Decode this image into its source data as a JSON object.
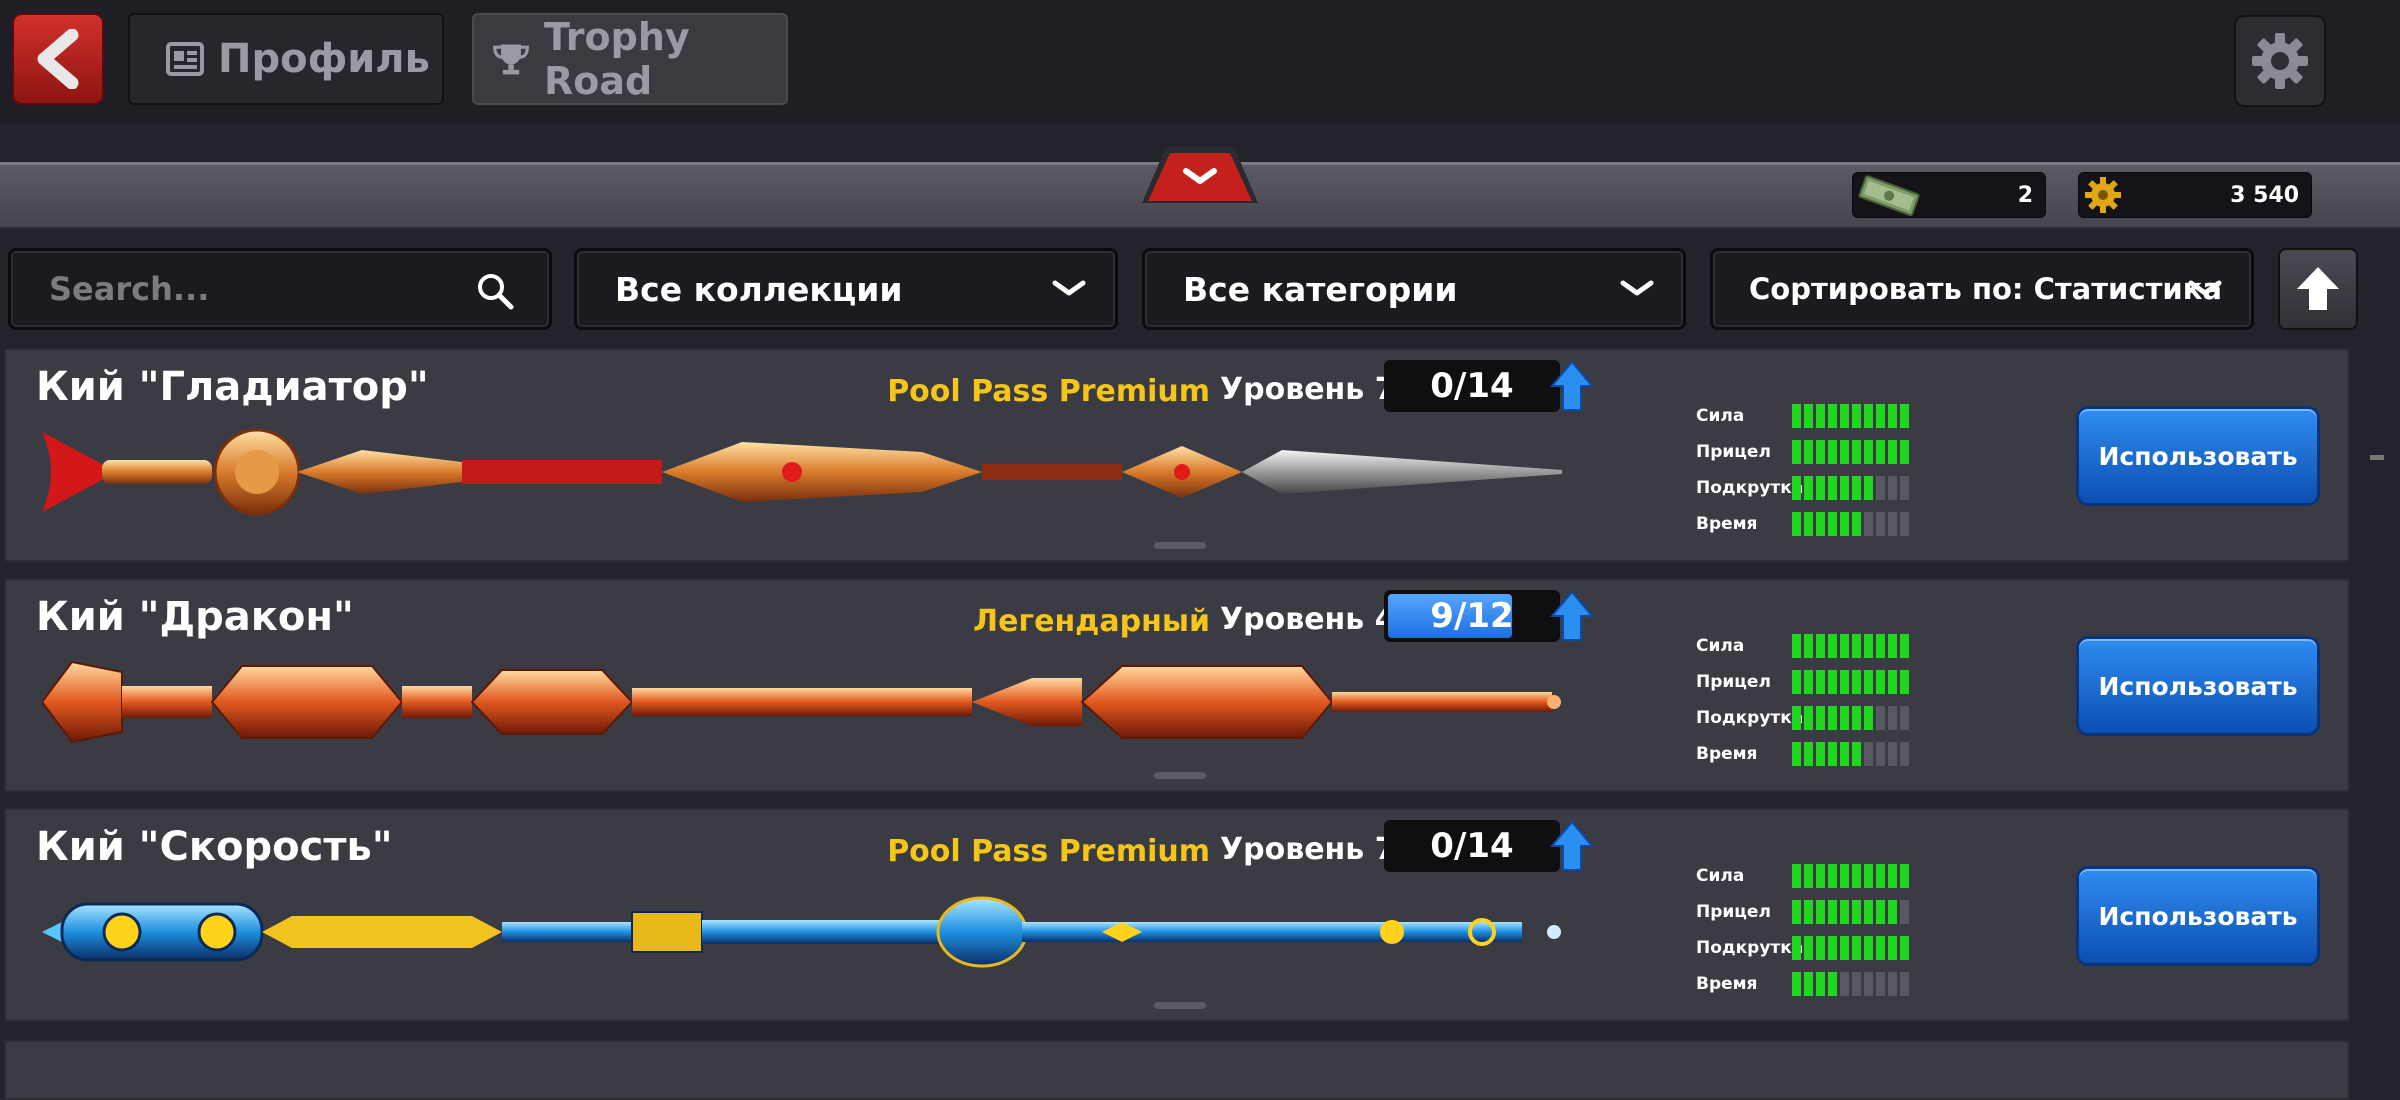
{
  "header": {
    "back_icon": "back-arrow-icon",
    "tabs": [
      {
        "label": "Профиль",
        "icon": "profile-card-icon"
      },
      {
        "label": "Trophy Road",
        "icon": "trophy-icon"
      }
    ],
    "settings_icon": "gear-icon"
  },
  "currency": {
    "cash": "2",
    "coins": "3 540"
  },
  "filters": {
    "search_placeholder": "Search...",
    "collections": "Все коллекции",
    "categories": "Все категории",
    "sort": "Сортировать по: Статистика"
  },
  "colors": {
    "accent_yellow": "#f5c518",
    "bar_green": "#1ed81e",
    "button_blue": "#1a6fe0",
    "back_red": "#c12722"
  },
  "stat_labels": {
    "power": "Сила",
    "aim": "Прицел",
    "spin": "Подкрутка",
    "time": "Время"
  },
  "cues": [
    {
      "name": "Кий \"Гладиатор\"",
      "rarity": "Pool Pass Premium",
      "level": "Уровень 7",
      "progress_text": "0/14",
      "progress": 0.0,
      "stats": {
        "power": 10,
        "aim": 10,
        "spin": 7,
        "time": 6
      },
      "stats_max": 10,
      "use_label": "Использовать"
    },
    {
      "name": "Кий \"Дракон\"",
      "rarity": "Легендарный",
      "level": "Уровень 4",
      "progress_text": "9/12",
      "progress": 0.75,
      "stats": {
        "power": 10,
        "aim": 10,
        "spin": 7,
        "time": 6
      },
      "stats_max": 10,
      "use_label": "Использовать"
    },
    {
      "name": "Кий \"Скорость\"",
      "rarity": "Pool Pass Premium",
      "level": "Уровень 7",
      "progress_text": "0/14",
      "progress": 0.0,
      "stats": {
        "power": 10,
        "aim": 9,
        "spin": 10,
        "time": 4
      },
      "stats_max": 10,
      "use_label": "Использовать"
    }
  ]
}
